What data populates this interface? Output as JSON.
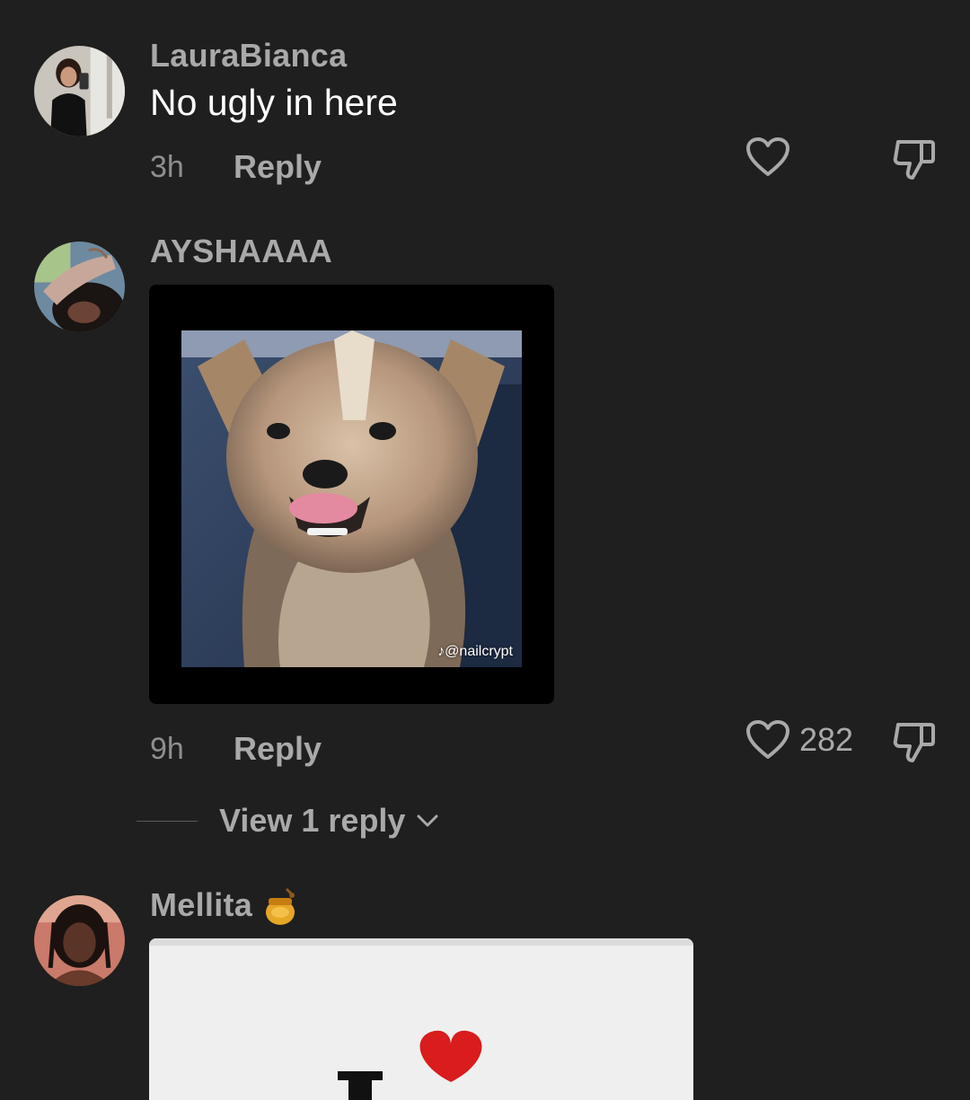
{
  "comments": [
    {
      "username": "LauraBianca",
      "text": "No ugly in here",
      "time": "3h",
      "reply_label": "Reply",
      "likes": ""
    },
    {
      "username": "AYSHAAAA",
      "media_watermark": "@nailcrypt",
      "time": "9h",
      "reply_label": "Reply",
      "likes": "282",
      "view_replies_label": "View 1 reply"
    },
    {
      "username": "Mellita"
    }
  ],
  "icons": {
    "like": "heart-outline-icon",
    "dislike": "thumbs-down-icon",
    "expand": "chevron-down-icon",
    "emoji": "honey-pot-emoji"
  },
  "colors": {
    "background": "#1f1f1f",
    "muted_text": "#a9a9a9",
    "primary_text": "#ffffff",
    "love_heart": "#e0231e"
  }
}
